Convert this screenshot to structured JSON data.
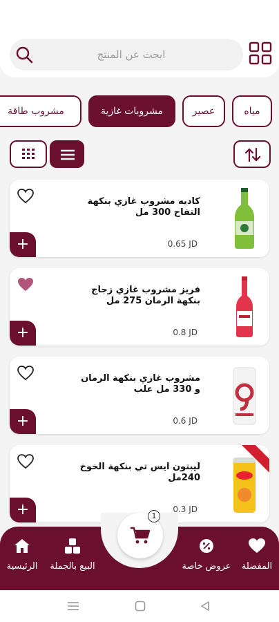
{
  "search": {
    "placeholder": "ابحث عن المنتج"
  },
  "categories": [
    {
      "label": "مياه"
    },
    {
      "label": "عصير"
    },
    {
      "label": "مشروبات غازية"
    },
    {
      "label": "مشروب طاقة"
    }
  ],
  "products": [
    {
      "name": "كاديه مشروب غازي بنكهة التفاح 300 مل",
      "price": "0.65 JD",
      "favorite": false,
      "image": "green-bottle"
    },
    {
      "name": "فريز مشروب غازي زجاج بنكهة الرمان 275 مل",
      "price": "0.8 JD",
      "favorite": true,
      "image": "red-bottle"
    },
    {
      "name": "مشروب غازي بنكهة الرمان و 330 مل علب",
      "price": "0.6 JD",
      "favorite": false,
      "image": "white-can"
    },
    {
      "name": "ليبتون ايس تي بنكهة الخوخ 240مل",
      "price": "0.3 JD",
      "favorite": false,
      "image": "yellow-can"
    }
  ],
  "cart": {
    "count": "1"
  },
  "nav": {
    "home": "الرئيسية",
    "wholesale": "البيع بالجملة",
    "offers": "عروض خاصة",
    "favorites": "المفضلة"
  },
  "colors": {
    "accent": "#6b0f2e",
    "favorite": "#b0567a"
  }
}
